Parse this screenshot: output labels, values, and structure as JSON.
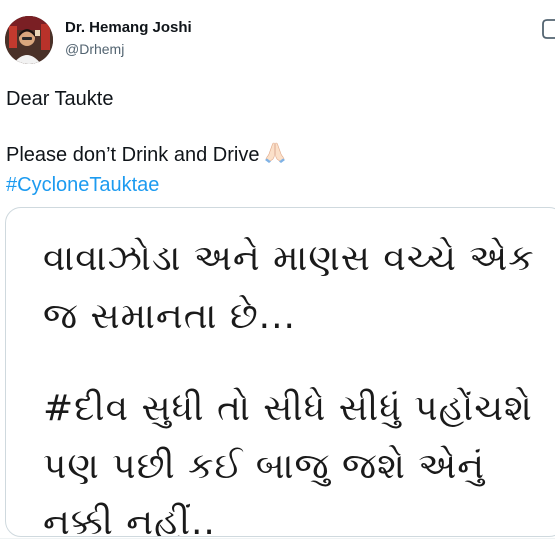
{
  "author": {
    "display_name": "Dr. Hemang Joshi",
    "handle": "@Drhemj",
    "avatar_icon": "profile-photo",
    "more_icon": "overflow-icon"
  },
  "tweet": {
    "line1": "Dear Taukte",
    "line2": "Please don’t Drink and Drive",
    "line2_emoji": "folded-hands",
    "hashtag": "#CycloneTauktae"
  },
  "media": {
    "lines": [
      "વાવાઝોડા અને માણસ વચ્ચે એક",
      "જ સમાનતા છે...",
      "#દીવ સુધી તો સીધે સીધું પહોંચશે",
      "પણ પછી કઈ બાજુ જશે એનું",
      "નક્કી નહીં.."
    ]
  },
  "colors": {
    "link": "#1d9bf0",
    "text": "#0f1419",
    "secondary": "#536471",
    "border": "#cfd9de"
  }
}
